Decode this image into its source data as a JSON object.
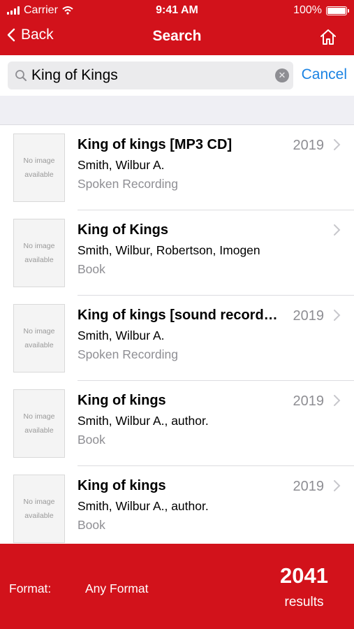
{
  "status_bar": {
    "carrier": "Carrier",
    "time": "9:41 AM",
    "battery": "100%"
  },
  "nav": {
    "back_label": "Back",
    "title": "Search"
  },
  "search": {
    "query": "King of Kings",
    "cancel_label": "Cancel"
  },
  "thumb_text": {
    "line1": "No image",
    "line2": "available"
  },
  "results": [
    {
      "title": "King of kings [MP3 CD]",
      "author": "Smith, Wilbur A.",
      "format": "Spoken Recording",
      "year": "2019"
    },
    {
      "title": "King of Kings",
      "author": "Smith, Wilbur, Robertson, Imogen",
      "format": "Book",
      "year": ""
    },
    {
      "title": "King of kings [sound recording]",
      "author": "Smith, Wilbur A.",
      "format": "Spoken Recording",
      "year": "2019"
    },
    {
      "title": "King of kings",
      "author": "Smith, Wilbur A., author.",
      "format": "Book",
      "year": "2019"
    },
    {
      "title": "King of kings",
      "author": "Smith, Wilbur A., author.",
      "format": "Book",
      "year": "2019"
    }
  ],
  "footer": {
    "format_label": "Format:",
    "format_value": "Any Format",
    "count": "2041",
    "count_label": "results"
  },
  "colors": {
    "brand": "#d2121b",
    "link": "#1b83e3",
    "secondary_text": "#8e8e93"
  }
}
